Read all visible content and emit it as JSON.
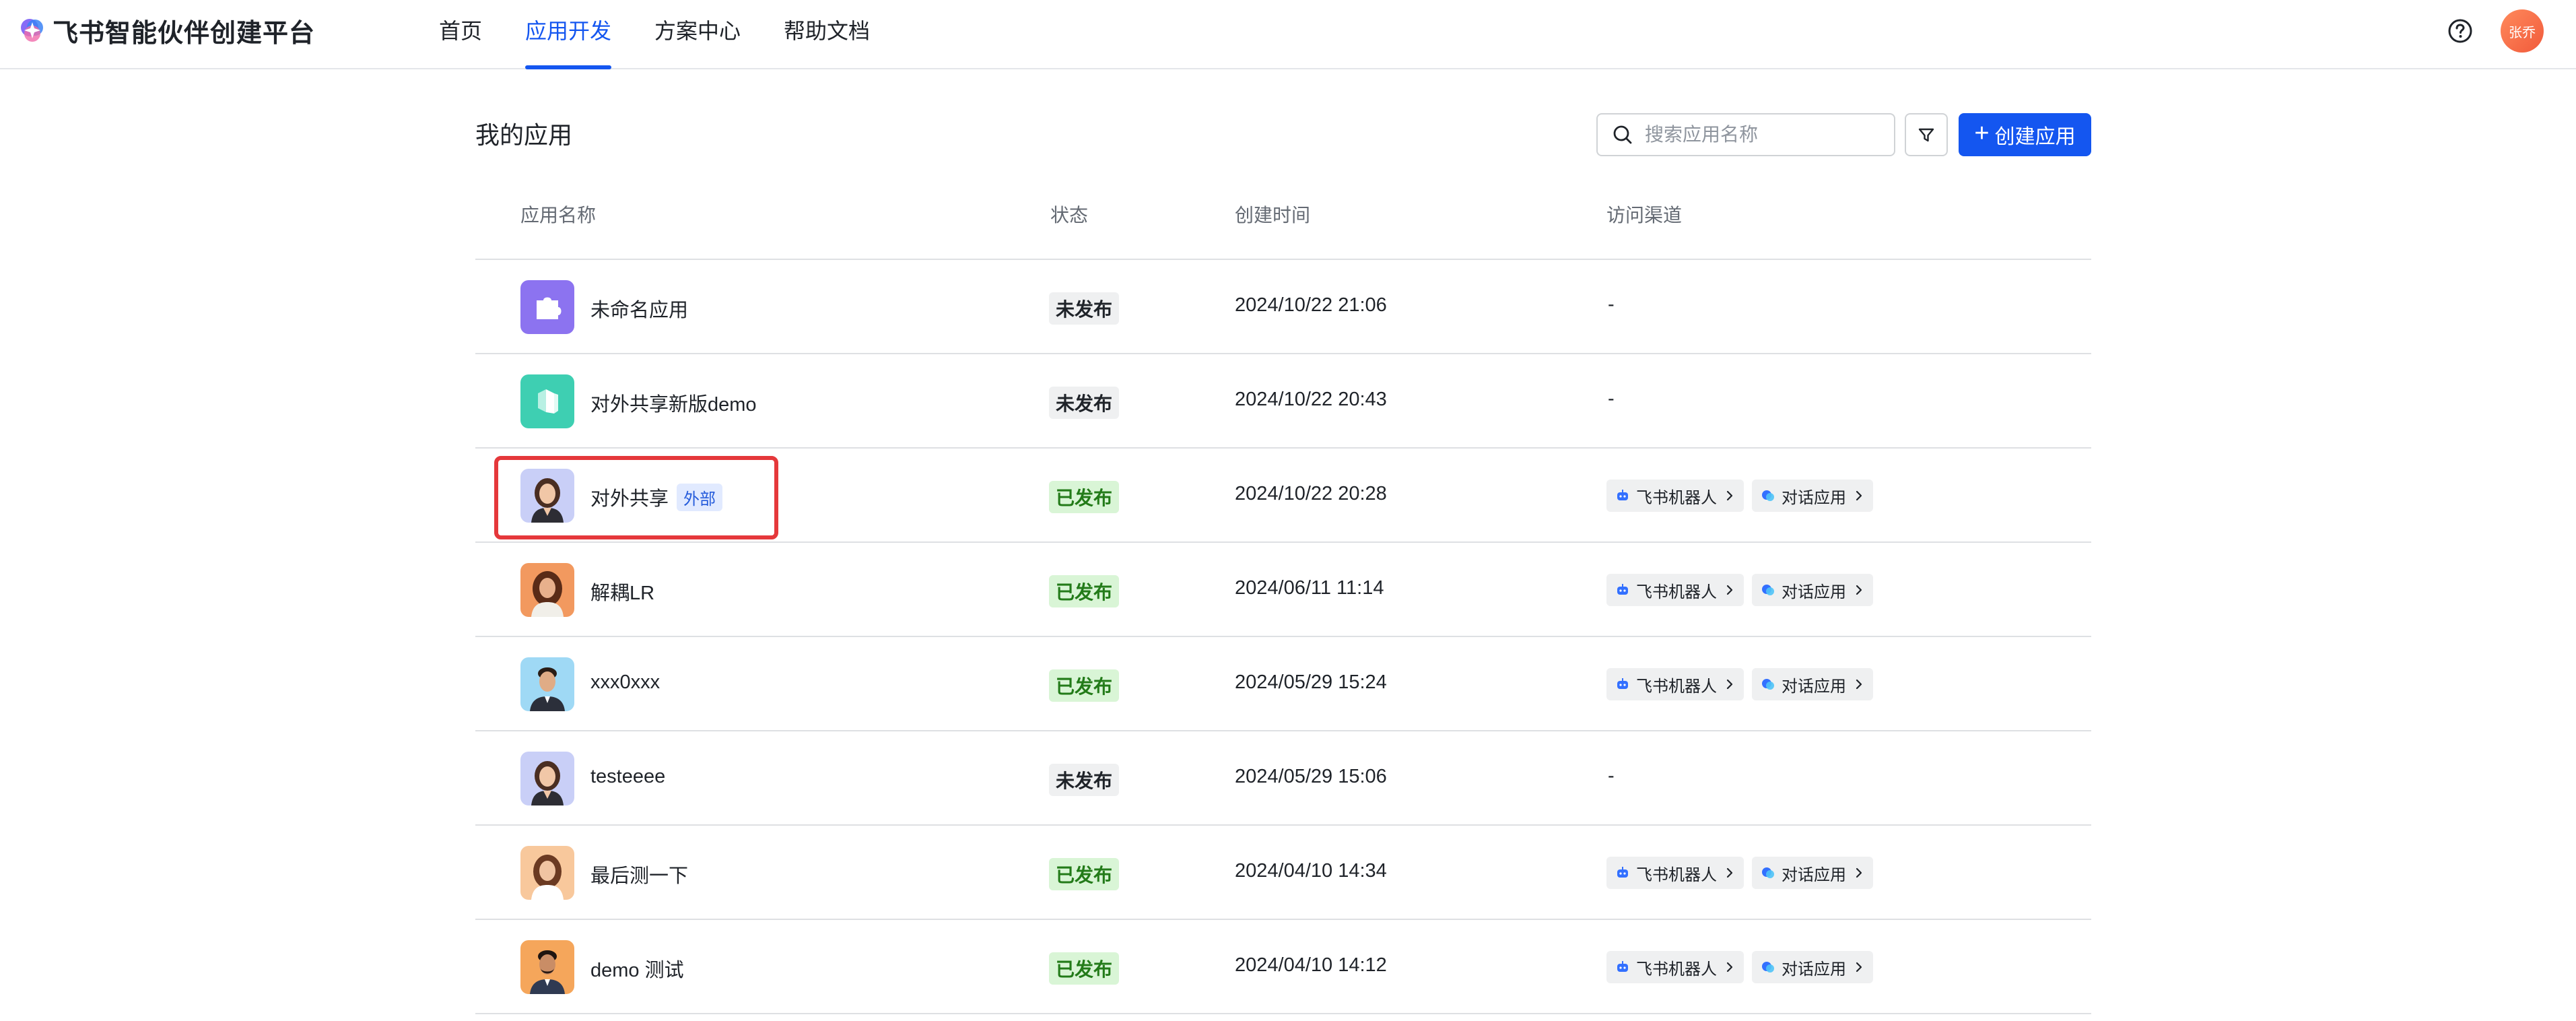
{
  "header": {
    "brand": "飞书智能伙伴创建平台",
    "nav": [
      "首页",
      "应用开发",
      "方案中心",
      "帮助文档"
    ],
    "active_nav": "应用开发",
    "user_avatar_text": "张乔"
  },
  "toolbar": {
    "page_title": "我的应用",
    "search_placeholder": "搜索应用名称",
    "create_label": "创建应用"
  },
  "table": {
    "columns": [
      "应用名称",
      "状态",
      "创建时间",
      "访问渠道"
    ],
    "rows": [
      {
        "name": "未命名应用",
        "status": "未发布",
        "time": "2024/10/22 21:06",
        "channels": "-",
        "icon": "puzzle-icon"
      },
      {
        "name": "对外共享新版demo",
        "status": "未发布",
        "time": "2024/10/22 20:43",
        "channels": "-",
        "icon": "cube-icon"
      },
      {
        "name": "对外共享",
        "tag": "外部",
        "status": "已发布",
        "time": "2024/10/22 20:28",
        "bot": "飞书机器人",
        "chat": "对话应用",
        "icon": "woman-avatar-icon"
      },
      {
        "name": "解耦LR",
        "status": "已发布",
        "time": "2024/06/11 11:14",
        "bot": "飞书机器人",
        "chat": "对话应用",
        "icon": "woman-avatar-icon"
      },
      {
        "name": "xxx0xxx",
        "status": "已发布",
        "time": "2024/05/29 15:24",
        "bot": "飞书机器人",
        "chat": "对话应用",
        "icon": "man-avatar-icon"
      },
      {
        "name": "testeeee",
        "status": "未发布",
        "time": "2024/05/29 15:06",
        "channels": "-",
        "icon": "woman-avatar-icon"
      },
      {
        "name": "最后测一下",
        "status": "已发布",
        "time": "2024/04/10 14:34",
        "bot": "飞书机器人",
        "chat": "对话应用",
        "icon": "woman-avatar-icon"
      },
      {
        "name": "demo 测试",
        "status": "已发布",
        "time": "2024/04/10 14:12",
        "bot": "飞书机器人",
        "chat": "对话应用",
        "icon": "man-avatar-icon"
      }
    ]
  },
  "colors": {
    "primary": "#1456f0",
    "published_bg": "#d9f5d6",
    "published_text": "#237b19",
    "unpublished_bg": "#eff0f1",
    "highlight": "#e5383b"
  }
}
